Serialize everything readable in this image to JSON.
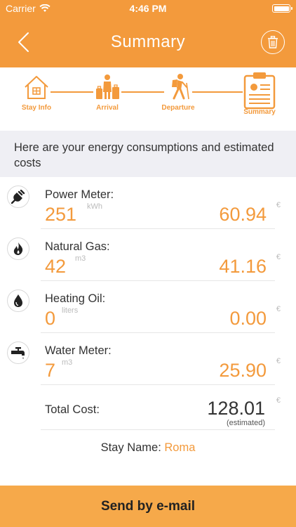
{
  "status": {
    "carrier": "Carrier",
    "time": "4:46 PM"
  },
  "nav": {
    "title": "Summary",
    "back_icon": "chevron-left-icon",
    "delete_icon": "trash-icon"
  },
  "steps": [
    {
      "label": "Stay Info",
      "icon": "house-icon"
    },
    {
      "label": "Arrival",
      "icon": "person-luggage-icon"
    },
    {
      "label": "Departure",
      "icon": "hiker-icon"
    },
    {
      "label": "Summary",
      "icon": "clipboard-icon",
      "active": true
    }
  ],
  "intro": "Here are your energy consumptions and estimated costs",
  "meters": [
    {
      "name": "Power Meter:",
      "value": "251",
      "unit": "kWh",
      "cost": "60.94",
      "currency": "€",
      "icon": "plug-icon"
    },
    {
      "name": "Natural Gas:",
      "value": "42",
      "unit": "m3",
      "cost": "41.16",
      "currency": "€",
      "icon": "flame-icon"
    },
    {
      "name": "Heating Oil:",
      "value": "0",
      "unit": "liters",
      "cost": "0.00",
      "currency": "€",
      "icon": "oil-drop-icon"
    },
    {
      "name": "Water Meter:",
      "value": "7",
      "unit": "m3",
      "cost": "25.90",
      "currency": "€",
      "icon": "faucet-icon"
    }
  ],
  "total": {
    "label": "Total Cost:",
    "amount": "128.01",
    "note": "(estimated)",
    "currency": "€"
  },
  "stay": {
    "label": "Stay Name:",
    "value": "Roma"
  },
  "send_button": "Send by e-mail",
  "colors": {
    "accent": "#f39a3c",
    "button": "#f6a94a",
    "intro_bg": "#efeff4"
  }
}
